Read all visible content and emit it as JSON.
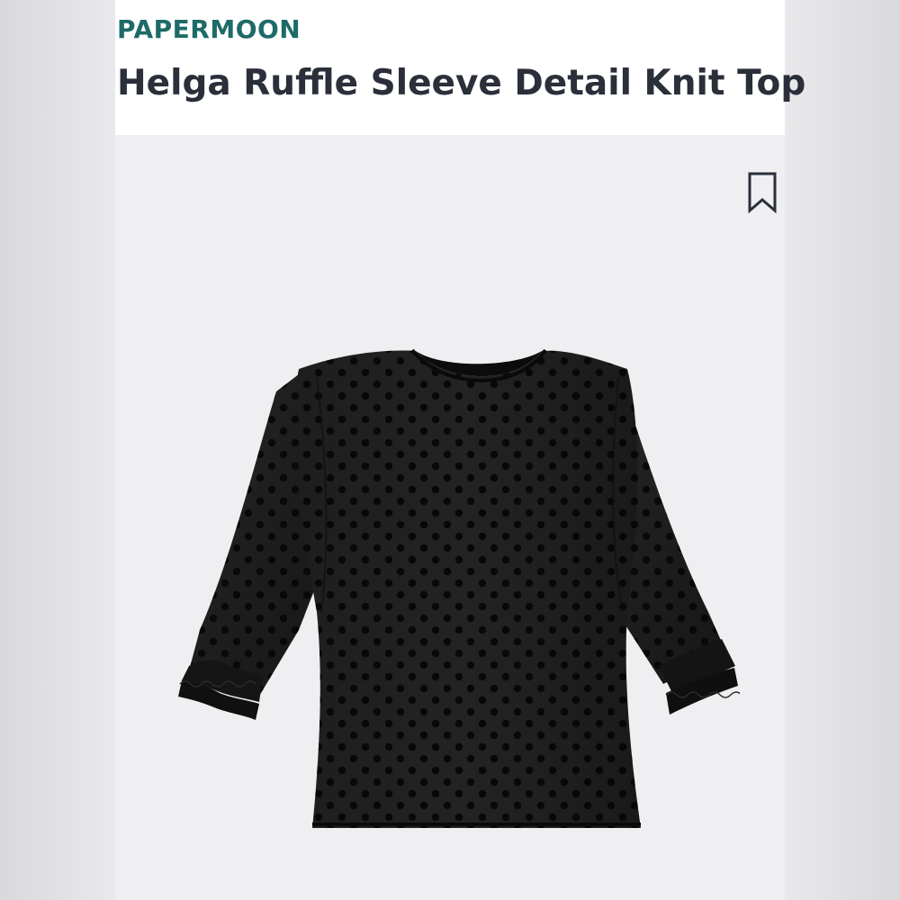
{
  "product": {
    "brand": "PAPERMOON",
    "name": "Helga Ruffle Sleeve Detail Knit Top",
    "image_icon": "black-polka-dot-ruffle-sleeve-top-image"
  },
  "actions": {
    "save_icon": "bookmark-icon"
  },
  "colors": {
    "brand": "#1d6b68",
    "title": "#2a2f3a",
    "garment": "#1b1b1b",
    "background": "#efeff1"
  }
}
